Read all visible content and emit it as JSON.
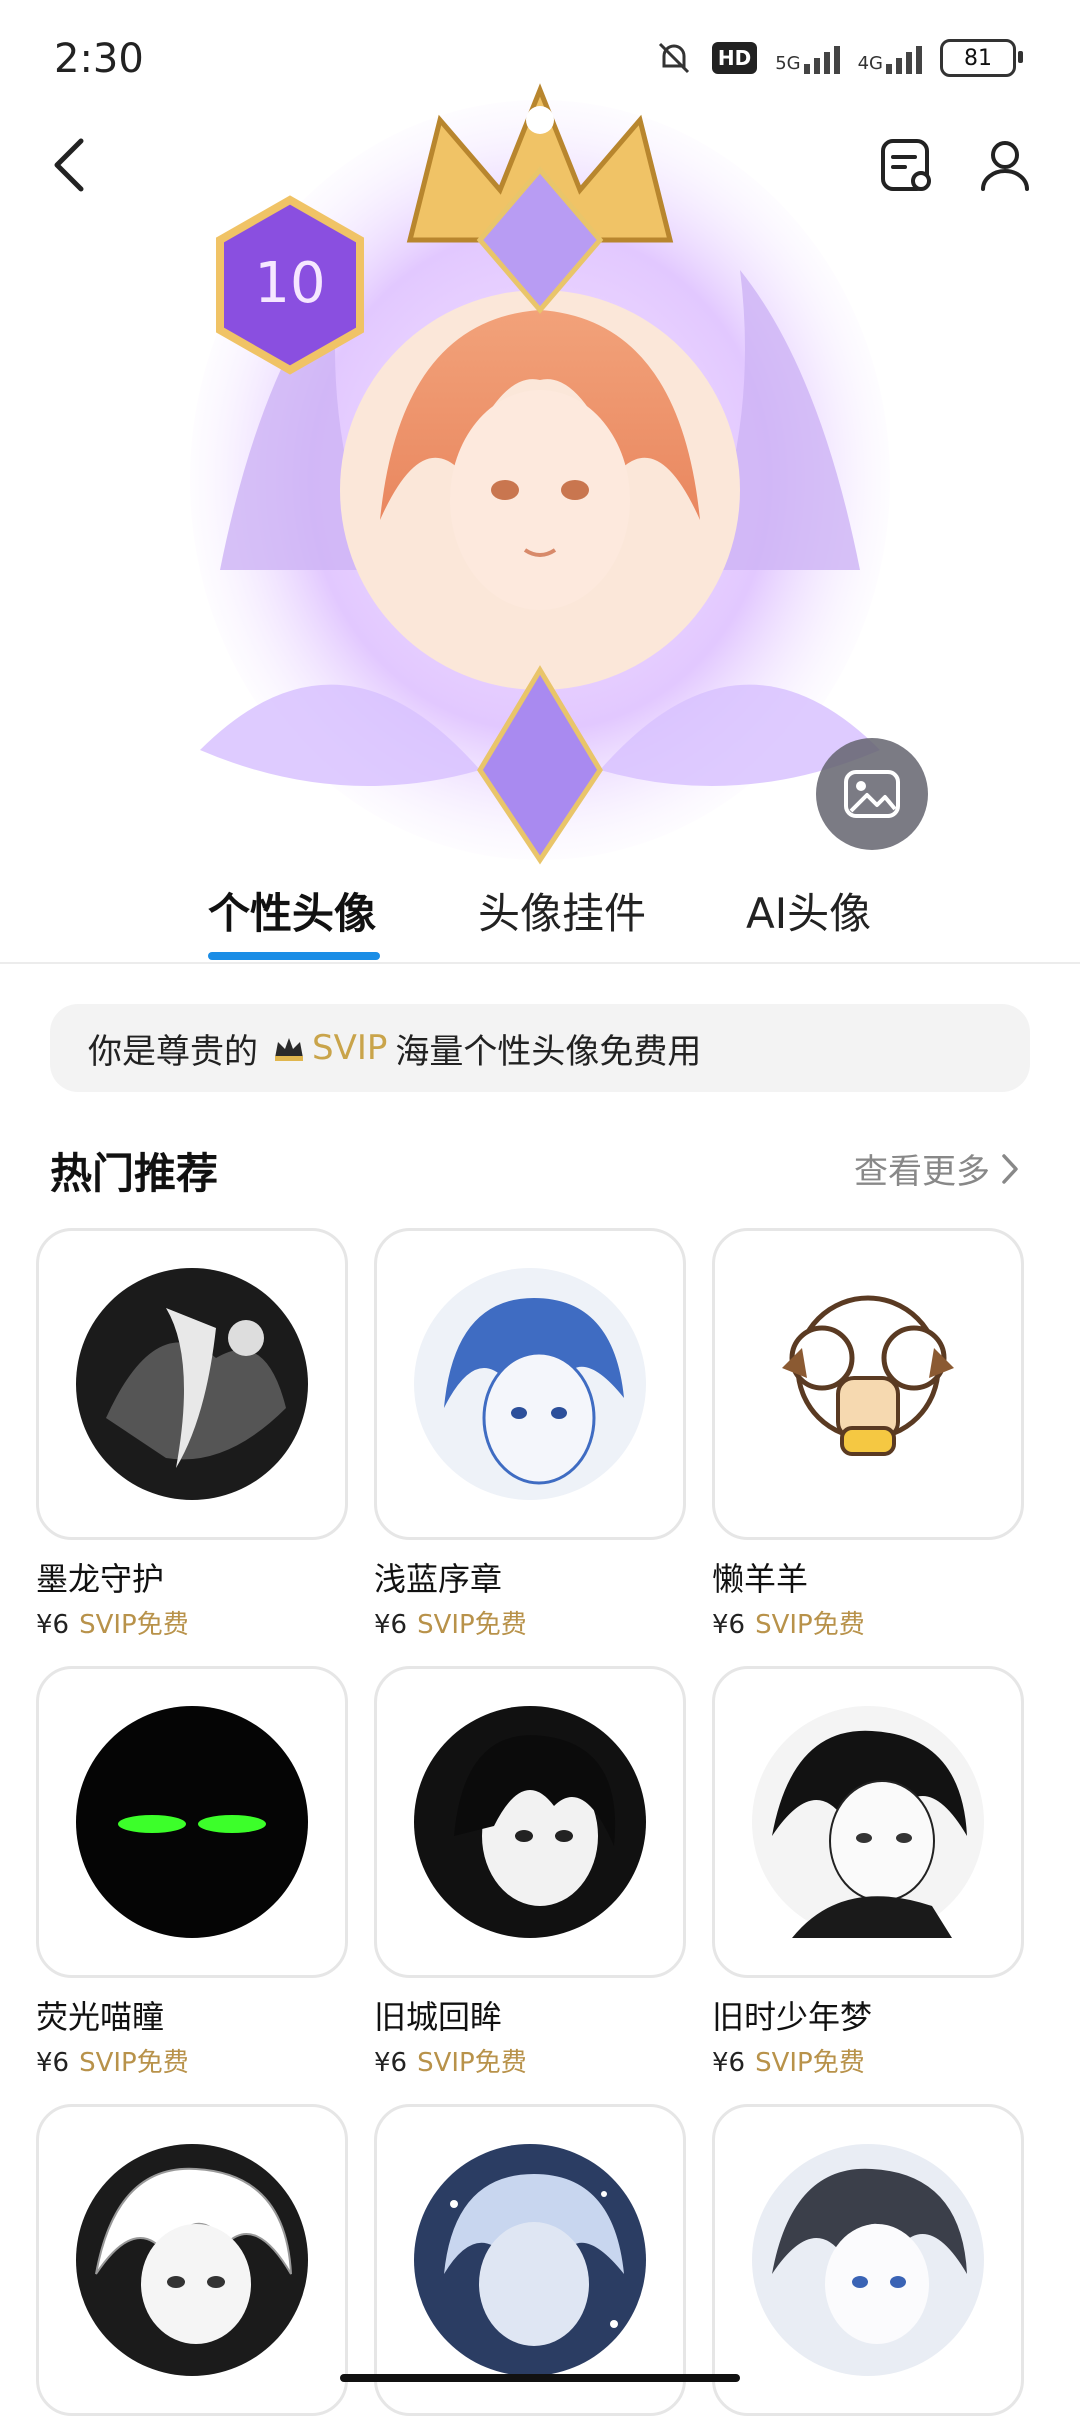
{
  "status_bar": {
    "time": "2:30",
    "hd": "HD",
    "net5g": "5G",
    "net4g": "4G",
    "battery": "81"
  },
  "header": {
    "back_icon": "chevron-left-icon",
    "icon_a": "notes-icon",
    "icon_b": "person-icon"
  },
  "hero": {
    "badge_level": "10"
  },
  "tabs": [
    {
      "label": "个性头像",
      "active": true
    },
    {
      "label": "头像挂件",
      "active": false
    },
    {
      "label": "AI头像",
      "active": false
    }
  ],
  "notice": {
    "prefix": "你是尊贵的",
    "svip": "SVIP",
    "suffix": "海量个性头像免费用"
  },
  "section": {
    "title": "热门推荐",
    "more": "查看更多"
  },
  "items": [
    {
      "title": "墨龙守护",
      "price": "¥6",
      "free": "SVIP免费"
    },
    {
      "title": "浅蓝序章",
      "price": "¥6",
      "free": "SVIP免费"
    },
    {
      "title": "懒羊羊",
      "price": "¥6",
      "free": "SVIP免费"
    },
    {
      "title": "荧光喵瞳",
      "price": "¥6",
      "free": "SVIP免费"
    },
    {
      "title": "旧城回眸",
      "price": "¥6",
      "free": "SVIP免费"
    },
    {
      "title": "旧时少年梦",
      "price": "¥6",
      "free": "SVIP免费"
    },
    {
      "title": "",
      "price": "",
      "free": ""
    },
    {
      "title": "",
      "price": "",
      "free": ""
    },
    {
      "title": "",
      "price": "",
      "free": ""
    }
  ],
  "colors": {
    "accent": "#1a8de6",
    "svip_gold": "#c9a44a"
  }
}
